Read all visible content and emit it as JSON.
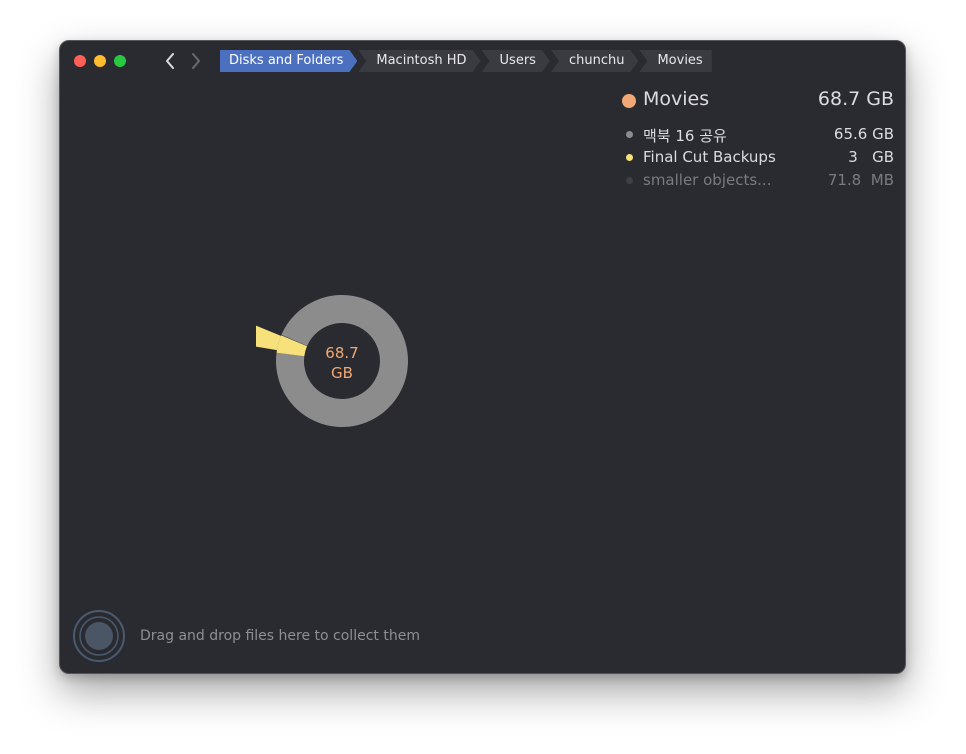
{
  "window": {
    "controls": [
      "close",
      "minimize",
      "zoom"
    ]
  },
  "toolbar": {
    "back_icon": "chevron-left-icon",
    "forward_icon": "chevron-right-icon"
  },
  "breadcrumb": [
    "Disks and Folders",
    "Macintosh HD",
    "Users",
    "chunchu",
    "Movies"
  ],
  "legend": {
    "folder": {
      "name": "Movies",
      "size": "68.7 GB",
      "color": "#f1a874"
    },
    "items": [
      {
        "name": "맥북 16 공유",
        "size": "65.6 GB",
        "color": "#8c8c8c"
      },
      {
        "name": "Final Cut Backups",
        "size": "3   GB",
        "color": "#f7e17a"
      },
      {
        "name": "smaller objects...",
        "size": "71.8  MB",
        "color": "#3f4045"
      }
    ]
  },
  "chart_data": {
    "type": "pie",
    "center_label_value": "68.7",
    "center_label_unit": "GB",
    "slices": [
      {
        "label": "맥북 16 공유",
        "value": 65.6,
        "unit": "GB",
        "color": "#8c8c8c"
      },
      {
        "label": "Final Cut Backups",
        "value": 3,
        "unit": "GB",
        "color": "#f7e17a"
      },
      {
        "label": "smaller objects...",
        "value": 0.0718,
        "unit": "GB",
        "color": "#3f4045"
      }
    ]
  },
  "footer": {
    "drop_text": "Drag and drop files here to collect them"
  }
}
